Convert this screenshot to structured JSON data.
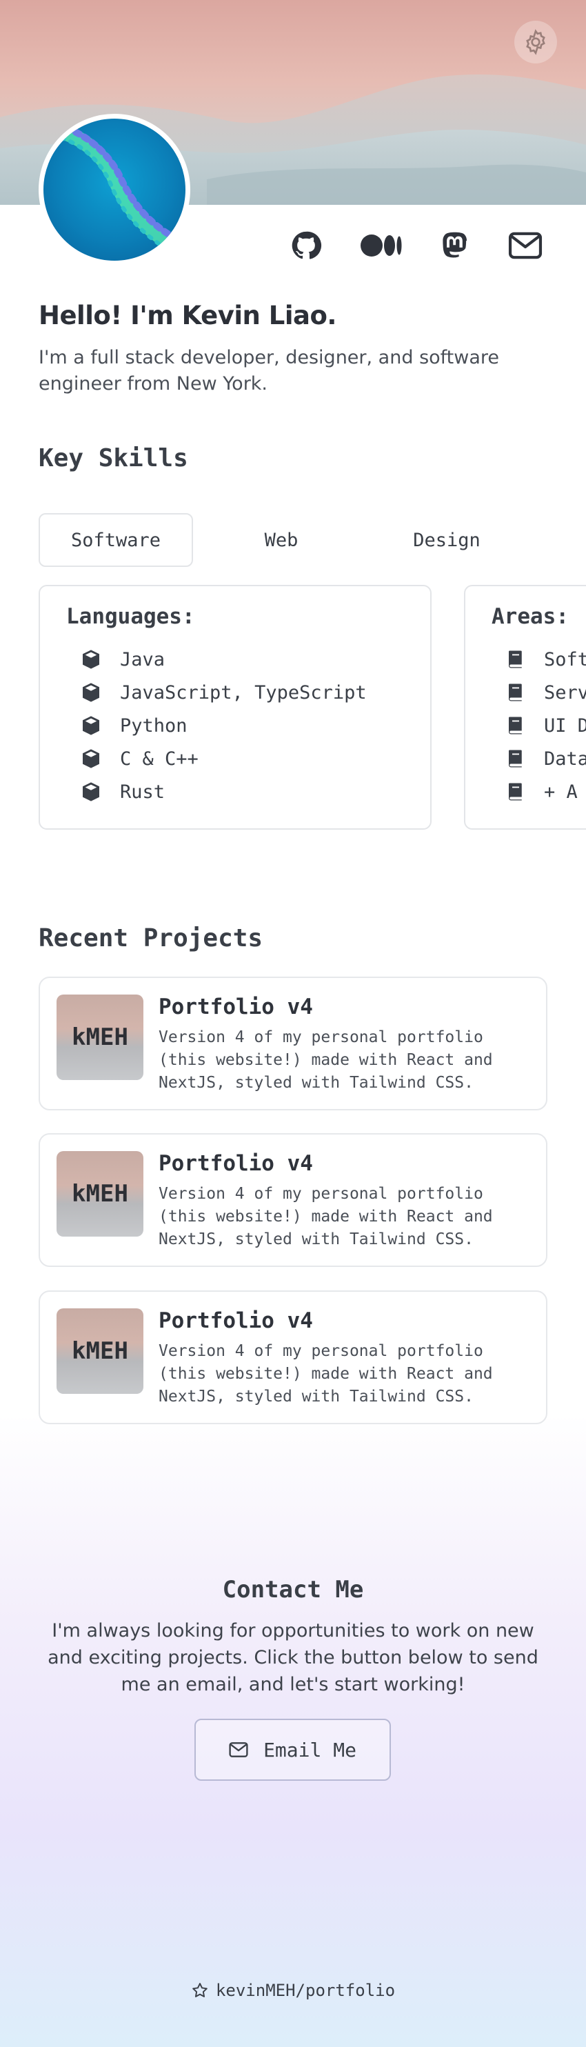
{
  "colors": {
    "text": "#3a3f47",
    "card_border": "#e3e5e8",
    "accent_border": "#b7b9d4"
  },
  "header": {
    "settings_icon": "gear-icon",
    "social": [
      {
        "name": "github-icon"
      },
      {
        "name": "medium-icon"
      },
      {
        "name": "mastodon-icon"
      },
      {
        "name": "mail-icon"
      }
    ]
  },
  "intro": {
    "greeting": "Hello! I'm Kevin Liao.",
    "bio": "I'm a full stack developer, designer, and software engineer from New York."
  },
  "skills": {
    "title": "Key Skills",
    "tabs": [
      {
        "label": "Software",
        "active": true
      },
      {
        "label": "Web",
        "active": false
      },
      {
        "label": "Design",
        "active": false
      }
    ],
    "cards": [
      {
        "heading": "Languages:",
        "icon": "cube-icon",
        "items": [
          "Java",
          "JavaScript, TypeScript",
          "Python",
          "C & C++",
          "Rust"
        ]
      },
      {
        "heading": "Areas:",
        "icon": "book-icon",
        "items": [
          "Soft",
          "Serv",
          "UI D",
          "Data",
          "+ A"
        ]
      }
    ]
  },
  "projects": {
    "title": "Recent Projects",
    "items": [
      {
        "thumb": "kMEH",
        "title": "Portfolio v4",
        "desc": "Version 4 of my personal portfolio (this website!) made with React and NextJS, styled with Tailwind CSS."
      },
      {
        "thumb": "kMEH",
        "title": "Portfolio v4",
        "desc": "Version 4 of my personal portfolio (this website!) made with React and NextJS, styled with Tailwind CSS."
      },
      {
        "thumb": "kMEH",
        "title": "Portfolio v4",
        "desc": "Version 4 of my personal portfolio (this website!) made with React and NextJS, styled with Tailwind CSS."
      }
    ]
  },
  "contact": {
    "title": "Contact Me",
    "text": "I'm always looking for opportunities to work on new and exciting projects. Click the button below to send me an email, and let's start working!",
    "button_label": "Email Me"
  },
  "footer": {
    "repo": "kevinMEH/portfolio",
    "icon": "star-icon"
  }
}
